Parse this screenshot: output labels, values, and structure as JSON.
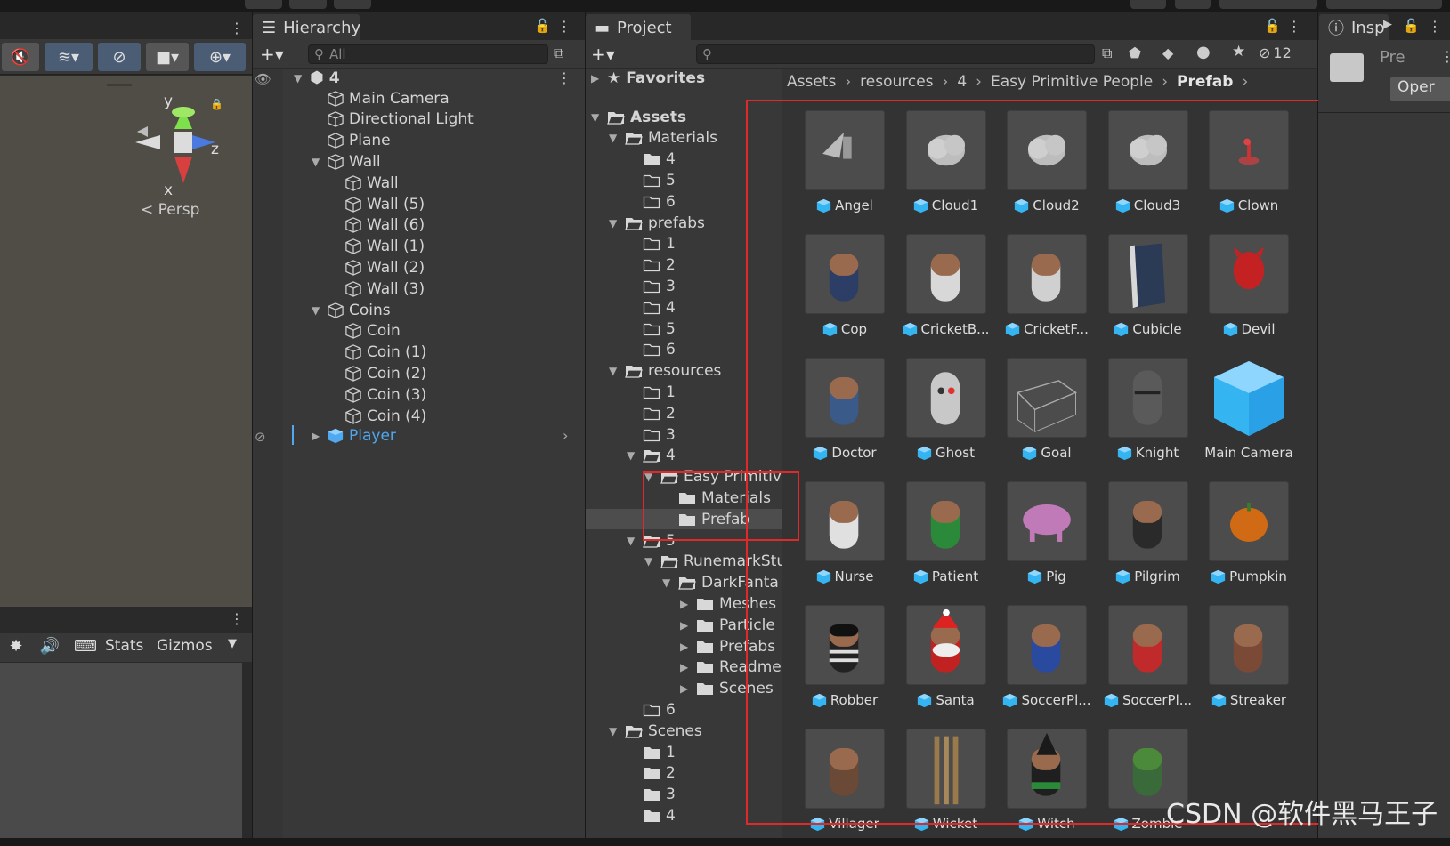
{
  "hierarchy": {
    "tab_label": "Hierarchy",
    "search_placeholder": "All",
    "root": "4",
    "items": [
      {
        "label": "Main Camera",
        "depth": 1,
        "arrow": ""
      },
      {
        "label": "Directional Light",
        "depth": 1,
        "arrow": ""
      },
      {
        "label": "Plane",
        "depth": 1,
        "arrow": ""
      },
      {
        "label": "Wall",
        "depth": 1,
        "arrow": "▼"
      },
      {
        "label": "Wall",
        "depth": 2,
        "arrow": ""
      },
      {
        "label": "Wall (5)",
        "depth": 2,
        "arrow": ""
      },
      {
        "label": "Wall (6)",
        "depth": 2,
        "arrow": ""
      },
      {
        "label": "Wall (1)",
        "depth": 2,
        "arrow": ""
      },
      {
        "label": "Wall (2)",
        "depth": 2,
        "arrow": ""
      },
      {
        "label": "Wall (3)",
        "depth": 2,
        "arrow": ""
      },
      {
        "label": "Coins",
        "depth": 1,
        "arrow": "▼"
      },
      {
        "label": "Coin",
        "depth": 2,
        "arrow": ""
      },
      {
        "label": "Coin (1)",
        "depth": 2,
        "arrow": ""
      },
      {
        "label": "Coin (2)",
        "depth": 2,
        "arrow": ""
      },
      {
        "label": "Coin (3)",
        "depth": 2,
        "arrow": ""
      },
      {
        "label": "Coin (4)",
        "depth": 2,
        "arrow": ""
      }
    ],
    "player_label": "Player"
  },
  "scene": {
    "axis_y": "y",
    "axis_z": "z",
    "axis_x": "x",
    "persp_label": "< Persp"
  },
  "game": {
    "stats_label": "Stats",
    "gizmos_label": "Gizmos"
  },
  "project": {
    "tab_label": "Project",
    "hidden_count": "12",
    "favorites_label": "Favorites",
    "breadcrumb": [
      "Assets",
      "resources",
      "4",
      "Easy Primitive People",
      "Prefab"
    ],
    "tree": [
      {
        "label": "Assets",
        "depth": 0,
        "arrow": "▼",
        "bold": true
      },
      {
        "label": "Materials",
        "depth": 1,
        "arrow": "▼"
      },
      {
        "label": "4",
        "depth": 2,
        "arrow": "",
        "filled": true
      },
      {
        "label": "5",
        "depth": 2,
        "arrow": ""
      },
      {
        "label": "6",
        "depth": 2,
        "arrow": ""
      },
      {
        "label": "prefabs",
        "depth": 1,
        "arrow": "▼"
      },
      {
        "label": "1",
        "depth": 2,
        "arrow": ""
      },
      {
        "label": "2",
        "depth": 2,
        "arrow": ""
      },
      {
        "label": "3",
        "depth": 2,
        "arrow": ""
      },
      {
        "label": "4",
        "depth": 2,
        "arrow": ""
      },
      {
        "label": "5",
        "depth": 2,
        "arrow": ""
      },
      {
        "label": "6",
        "depth": 2,
        "arrow": ""
      },
      {
        "label": "resources",
        "depth": 1,
        "arrow": "▼"
      },
      {
        "label": "1",
        "depth": 2,
        "arrow": ""
      },
      {
        "label": "2",
        "depth": 2,
        "arrow": ""
      },
      {
        "label": "3",
        "depth": 2,
        "arrow": ""
      },
      {
        "label": "4",
        "depth": 2,
        "arrow": "▼"
      },
      {
        "label": "Easy Primitiv",
        "depth": 3,
        "arrow": "▼"
      },
      {
        "label": "Materials",
        "depth": 4,
        "arrow": "",
        "filled": true
      },
      {
        "label": "Prefab",
        "depth": 4,
        "arrow": "",
        "filled": true,
        "selected": true
      },
      {
        "label": "5",
        "depth": 2,
        "arrow": "▼"
      },
      {
        "label": "RunemarkStu",
        "depth": 3,
        "arrow": "▼"
      },
      {
        "label": "DarkFanta",
        "depth": 4,
        "arrow": "▼"
      },
      {
        "label": "Meshes",
        "depth": 5,
        "arrow": "▶",
        "filled": true
      },
      {
        "label": "Particle",
        "depth": 5,
        "arrow": "▶",
        "filled": true
      },
      {
        "label": "Prefabs",
        "depth": 5,
        "arrow": "▶",
        "filled": true
      },
      {
        "label": "Readme",
        "depth": 5,
        "arrow": "▶",
        "filled": true
      },
      {
        "label": "Scenes",
        "depth": 5,
        "arrow": "▶",
        "filled": true
      },
      {
        "label": "6",
        "depth": 2,
        "arrow": ""
      },
      {
        "label": "Scenes",
        "depth": 1,
        "arrow": "▼"
      },
      {
        "label": "1",
        "depth": 2,
        "arrow": "",
        "filled": true
      },
      {
        "label": "2",
        "depth": 2,
        "arrow": "",
        "filled": true
      },
      {
        "label": "3",
        "depth": 2,
        "arrow": "",
        "filled": true
      },
      {
        "label": "4",
        "depth": 2,
        "arrow": "",
        "filled": true
      }
    ],
    "assets": [
      {
        "label": "Angel",
        "kind": "angel"
      },
      {
        "label": "Cloud1",
        "kind": "cloud"
      },
      {
        "label": "Cloud2",
        "kind": "cloud"
      },
      {
        "label": "Cloud3",
        "kind": "cloud"
      },
      {
        "label": "Clown",
        "kind": "clown"
      },
      {
        "label": "Cop",
        "kind": "person",
        "color": "#2c3e66"
      },
      {
        "label": "CricketB...",
        "kind": "person",
        "color": "#d8d8d8"
      },
      {
        "label": "CricketF...",
        "kind": "person",
        "color": "#d0d0d0"
      },
      {
        "label": "Cubicle",
        "kind": "cubicle"
      },
      {
        "label": "Devil",
        "kind": "devil"
      },
      {
        "label": "Doctor",
        "kind": "person",
        "color": "#3a5a8a"
      },
      {
        "label": "Ghost",
        "kind": "ghost"
      },
      {
        "label": "Goal",
        "kind": "goal"
      },
      {
        "label": "Knight",
        "kind": "knight"
      },
      {
        "label": "Main Camera",
        "kind": "camera"
      },
      {
        "label": "Nurse",
        "kind": "person",
        "color": "#e0e0e0"
      },
      {
        "label": "Patient",
        "kind": "person",
        "color": "#2a8a3a"
      },
      {
        "label": "Pig",
        "kind": "pig"
      },
      {
        "label": "Pilgrim",
        "kind": "person",
        "color": "#2a2a2a"
      },
      {
        "label": "Pumpkin",
        "kind": "pumpkin"
      },
      {
        "label": "Robber",
        "kind": "robber"
      },
      {
        "label": "Santa",
        "kind": "santa"
      },
      {
        "label": "SoccerPl...",
        "kind": "person",
        "color": "#2a4aa0"
      },
      {
        "label": "SoccerPl...",
        "kind": "person",
        "color": "#c02a2a"
      },
      {
        "label": "Streaker",
        "kind": "person",
        "color": "#7a4a36"
      },
      {
        "label": "Villager",
        "kind": "person",
        "color": "#6a4a36"
      },
      {
        "label": "Wicket",
        "kind": "wicket"
      },
      {
        "label": "Witch",
        "kind": "witch"
      },
      {
        "label": "Zombie",
        "kind": "zombie"
      }
    ]
  },
  "inspector": {
    "tab_label": "Insp",
    "pre_label": "Pre",
    "open_label": "Oper"
  },
  "watermark": "CSDN @软件黑马王子",
  "colors": {
    "accent_blue": "#2f9fe8",
    "highlight_red": "#e02a2a",
    "player_blue": "#4fa8f0"
  }
}
